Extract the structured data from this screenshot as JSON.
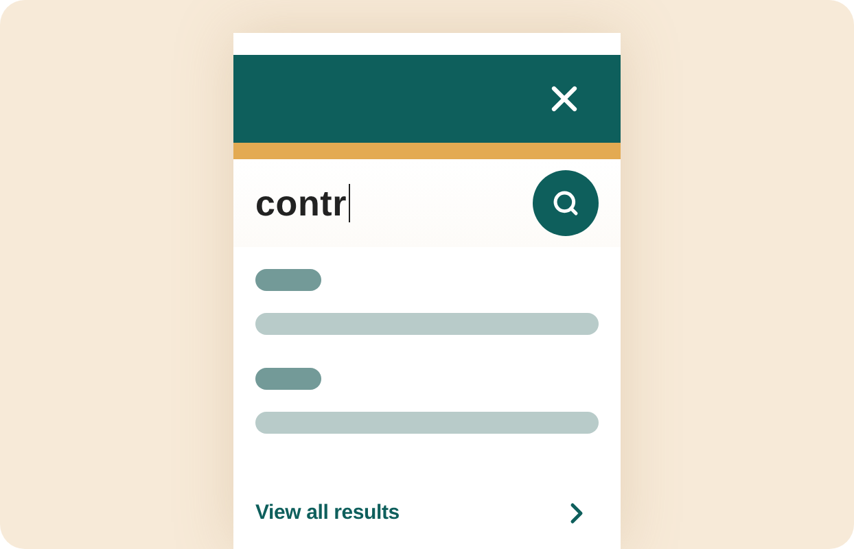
{
  "search": {
    "value": "contr",
    "focused": true
  },
  "results": [
    {
      "kind": "skeleton"
    },
    {
      "kind": "skeleton"
    }
  ],
  "link": {
    "label": "View all results"
  }
}
